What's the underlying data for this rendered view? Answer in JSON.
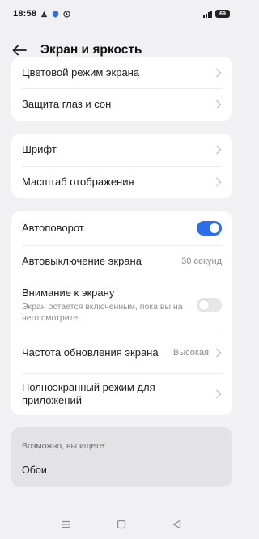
{
  "status_bar": {
    "time": "18:58",
    "battery": "69",
    "icons": [
      "notification-icon",
      "shield-icon",
      "clock-icon",
      "signal-icon",
      "battery-icon"
    ]
  },
  "header": {
    "title": "Экран и яркость",
    "back_icon": "arrow-left-icon"
  },
  "card_top": {
    "items": [
      {
        "label": "Цветовой режим экрана"
      },
      {
        "label": "Защита глаз и сон"
      }
    ]
  },
  "card_font": {
    "items": [
      {
        "label": "Шрифт"
      },
      {
        "label": "Масштаб отображения"
      }
    ]
  },
  "card_settings": {
    "auto_rotate": {
      "label": "Автоповорот",
      "enabled": true
    },
    "screen_timeout": {
      "label": "Автовыключение экрана",
      "value": "30 секунд"
    },
    "screen_attention": {
      "label": "Внимание к экрану",
      "description": "Экран остается включенным, пока вы на него смотрите.",
      "enabled": false
    },
    "refresh_rate": {
      "label": "Частота обновления экрана",
      "value": "Высокая"
    },
    "fullscreen_apps": {
      "label": "Полноэкранный режим для приложений"
    }
  },
  "suggestions": {
    "hint": "Возможно, вы ищете:",
    "items": [
      {
        "label": "Обои"
      }
    ]
  },
  "nav_bar": {
    "icons": [
      "menu-icon",
      "home-icon",
      "back-icon"
    ]
  },
  "colors": {
    "accent": "#2c6ee8",
    "background": "#f1f1f3",
    "card": "#ffffff"
  }
}
